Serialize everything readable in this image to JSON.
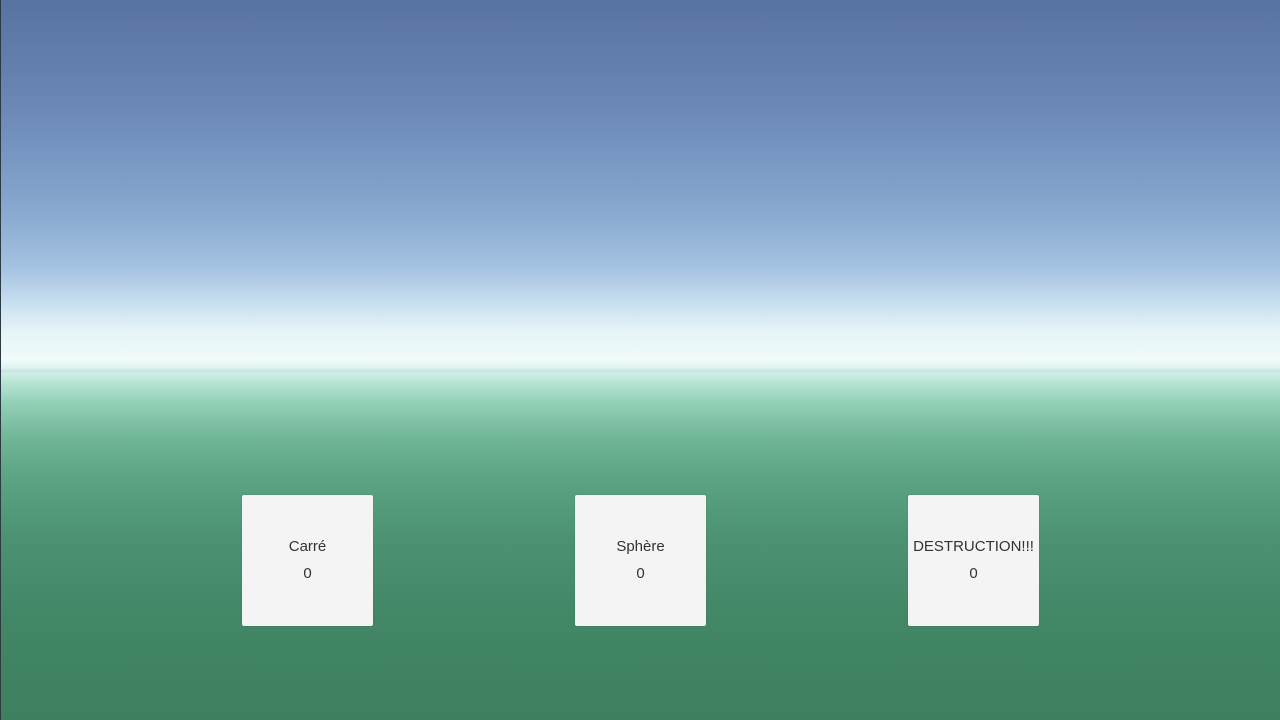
{
  "scene": {
    "sky_top_color": "#5873a1",
    "horizon_color": "#f0faf9",
    "ground_color": "#3d7f5f"
  },
  "buttons": [
    {
      "label": "Carré",
      "count": "0"
    },
    {
      "label": "Sphère",
      "count": "0"
    },
    {
      "label": "DESTRUCTION!!!",
      "count": "0"
    }
  ]
}
